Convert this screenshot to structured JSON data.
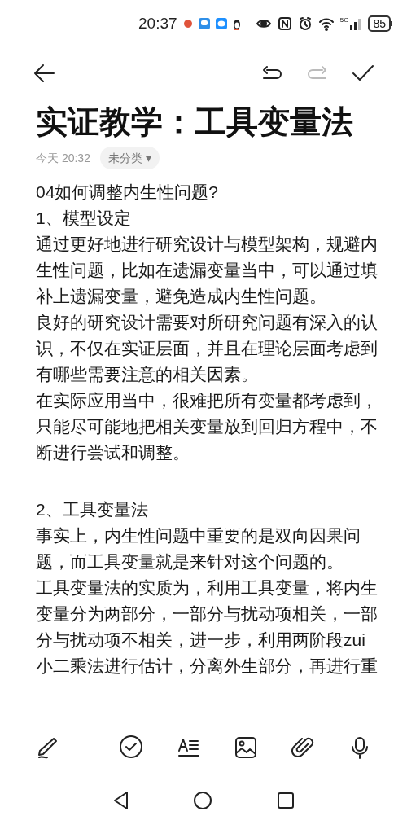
{
  "status_bar": {
    "time": "20:37",
    "network": "5G",
    "battery": "85"
  },
  "note": {
    "title": "实证教学：工具变量法",
    "date": "今天 20:32",
    "category": "未分类 ▾",
    "paragraphs": [
      {
        "kind": "line",
        "text": "04如何调整内生性问题?"
      },
      {
        "kind": "line",
        "text": "1、模型设定"
      },
      {
        "kind": "line",
        "text": "通过更好地进行研究设计与模型架构，规避内生性问题，比如在遗漏变量当中，可以通过填补上遗漏变量，避免造成内生性问题。"
      },
      {
        "kind": "line",
        "text": "良好的研究设计需要对所研究问题有深入的认识，不仅在实证层面，并且在理论层面考虑到有哪些需要注意的相关因素。"
      },
      {
        "kind": "line",
        "text": "在实际应用当中，很难把所有变量都考虑到，只能尽可能地把相关变量放到回归方程中，不断进行尝试和调整。"
      },
      {
        "kind": "blank"
      },
      {
        "kind": "line",
        "text": "2、工具变量法"
      },
      {
        "kind": "line",
        "text": "事实上，内生性问题中重要的是双向因果问题，而工具变量就是来针对这个问题的。"
      },
      {
        "kind": "line",
        "text": "工具变量法的实质为，利用工具变量，将内生变量分为两部分，一部分与扰动项相关，一部分与扰动项不相关，进一步，利用两阶段zui小二乘法进行估计，分离外生部分，再进行重"
      }
    ]
  }
}
